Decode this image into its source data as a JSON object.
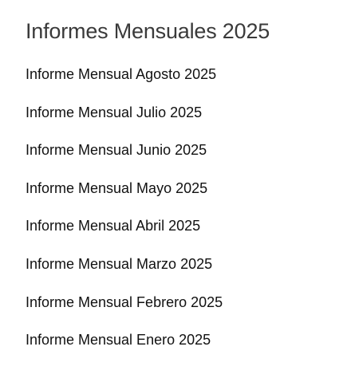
{
  "page": {
    "title": "Informes Mensuales 2025"
  },
  "reports": [
    {
      "label": "Informe Mensual Agosto 2025"
    },
    {
      "label": "Informe Mensual Julio 2025"
    },
    {
      "label": "Informe Mensual Junio 2025"
    },
    {
      "label": "Informe Mensual Mayo 2025"
    },
    {
      "label": "Informe Mensual Abril 2025"
    },
    {
      "label": "Informe Mensual Marzo 2025"
    },
    {
      "label": "Informe Mensual Febrero 2025"
    },
    {
      "label": "Informe Mensual Enero 2025"
    }
  ],
  "colors": {
    "title": "#3a3a3a",
    "link": "#111111",
    "background": "#ffffff"
  }
}
